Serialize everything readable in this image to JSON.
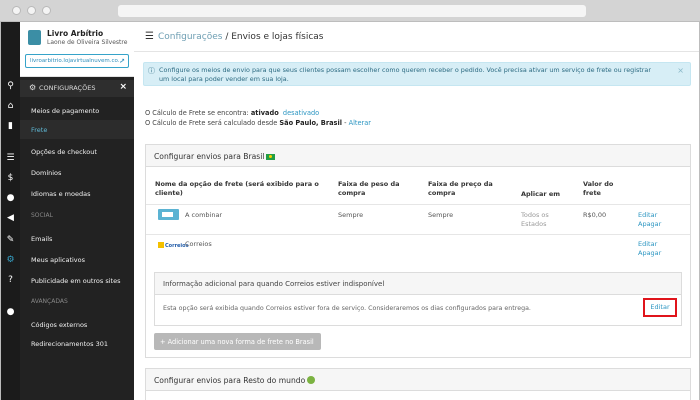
{
  "store": {
    "name": "Livro Arbítrio",
    "owner": "Laone de Oliveira Silvestre",
    "url": "livroarbitrio.lojavirtualnuvem.co..."
  },
  "sidebar": {
    "config_header": "CONFIGURAÇÕES",
    "items": [
      {
        "label": "Meios de pagamento"
      },
      {
        "label": "Frete"
      },
      {
        "label": "Opções de checkout"
      },
      {
        "label": "Domínios"
      },
      {
        "label": "Idiomas e moedas"
      },
      {
        "label": "Emails"
      },
      {
        "label": "Meus aplicativos"
      },
      {
        "label": "Publicidade em outros sites"
      },
      {
        "label": "Códigos externos"
      },
      {
        "label": "Redirecionamentos 301"
      }
    ],
    "sections": {
      "social": "SOCIAL",
      "advanced": "AVANÇADAS"
    }
  },
  "header": {
    "crumb_root": "Configurações",
    "crumb_sep": " / ",
    "crumb_current": "Envios e lojas físicas"
  },
  "alert": {
    "line1": "Configure os meios de envio para que seus clientes possam escolher como querem receber o pedido. Você precisa ativar um serviço de frete ou registrar",
    "line2": "um local para poder vender em sua loja."
  },
  "calc": {
    "status_prefix": "O Cálculo de Frete se encontra: ",
    "status_value": "ativado",
    "status_link": "desativado",
    "origin_prefix": "O Cálculo de Frete será calculado desde ",
    "origin_value": "São Paulo, Brasil",
    "origin_sep": " - ",
    "origin_link": "Alterar"
  },
  "brazil_panel": {
    "title": "Configurar envios para Brasil",
    "columns": {
      "name_1": "Nome da opção de frete (será exibido para o",
      "name_2": "cliente)",
      "weight_1": "Faixa de peso da",
      "weight_2": "compra",
      "price_1": "Faixa de preço da",
      "price_2": "compra",
      "apply": "Aplicar em",
      "value_1": "Valor do",
      "value_2": "frete"
    },
    "rows": [
      {
        "name": "A combinar",
        "weight": "Sempre",
        "price": "Sempre",
        "apply_1": "Todos os",
        "apply_2": "Estados",
        "value": "R$0,00",
        "edit": "Editar",
        "delete": "Apagar"
      },
      {
        "name": "Correios",
        "edit": "Editar",
        "delete": "Apagar"
      }
    ],
    "correios_logo": "Correios",
    "sub_title": "Informação adicional para quando Correios estiver indisponível",
    "sub_text": "Esta opção será exibida quando Correios estiver fora de serviço. Consideraremos os dias configurados para entrega.",
    "sub_edit": "Editar",
    "add_button": "+ Adicionar uma nova forma de frete no Brasil"
  },
  "world_panel": {
    "title": "Configurar envios para Resto do mundo"
  }
}
